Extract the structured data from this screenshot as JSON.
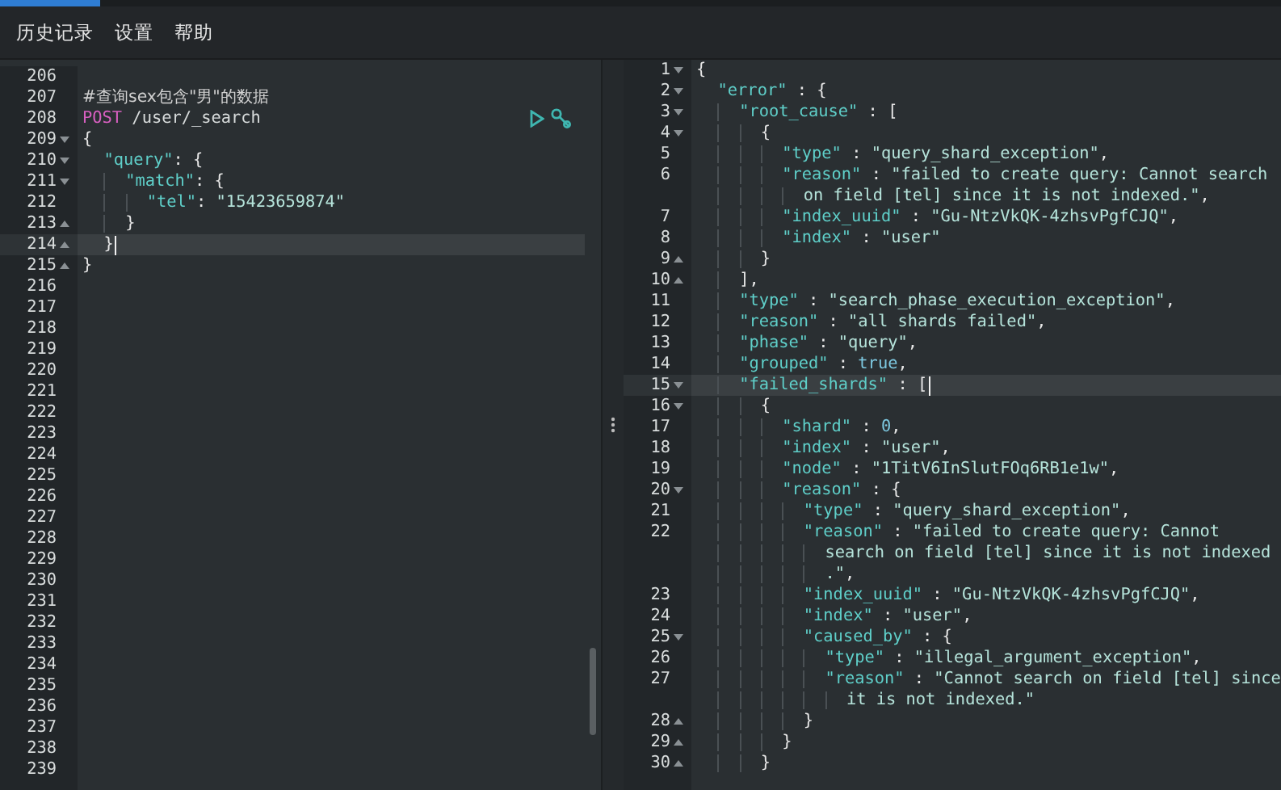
{
  "menu": [
    {
      "label": "历史记录"
    },
    {
      "label": "设置"
    },
    {
      "label": "帮助"
    }
  ],
  "request_editor": {
    "lines": [
      {
        "number": "206",
        "fold_start": false,
        "fold_end": false,
        "active": false,
        "actions": false
      },
      {
        "number": "207",
        "fold_start": false,
        "fold_end": false,
        "active": false,
        "actions": false,
        "tokens": [
          {
            "kind": "comment",
            "text": "#查询sex包含\"男\"的数据"
          }
        ]
      },
      {
        "number": "208",
        "fold_start": false,
        "fold_end": false,
        "active": false,
        "actions": true,
        "tokens": [
          {
            "kind": "method",
            "text": "POST"
          },
          {
            "kind": "path",
            "text": " /user/_search"
          }
        ]
      },
      {
        "number": "209",
        "fold_start": true,
        "fold_end": false,
        "active": false,
        "actions": false,
        "tokens": [
          {
            "kind": "punct",
            "text": "{"
          }
        ]
      },
      {
        "number": "210",
        "fold_start": true,
        "fold_end": false,
        "active": false,
        "actions": false,
        "tokens": [
          {
            "kind": "key",
            "text": "  \"query\""
          },
          {
            "kind": "punct",
            "text": ": {"
          }
        ]
      },
      {
        "number": "211",
        "fold_start": true,
        "fold_end": false,
        "active": false,
        "actions": false,
        "tokens": [
          {
            "kind": "key",
            "text": "    \"match\""
          },
          {
            "kind": "punct",
            "text": ": {"
          }
        ]
      },
      {
        "number": "212",
        "fold_start": false,
        "fold_end": false,
        "active": false,
        "actions": false,
        "tokens": [
          {
            "kind": "key",
            "text": "      \"tel\""
          },
          {
            "kind": "punct",
            "text": ": "
          },
          {
            "kind": "string",
            "text": "\"15423659874\""
          }
        ]
      },
      {
        "number": "213",
        "fold_start": false,
        "fold_end": true,
        "active": false,
        "actions": false,
        "tokens": [
          {
            "kind": "punct",
            "text": "    }"
          }
        ]
      },
      {
        "number": "214",
        "fold_start": false,
        "fold_end": true,
        "active": true,
        "actions": false,
        "tokens": [
          {
            "kind": "punct",
            "text": "  }"
          }
        ]
      },
      {
        "number": "215",
        "fold_start": false,
        "fold_end": true,
        "active": false,
        "actions": false,
        "tokens": [
          {
            "kind": "punct",
            "text": "}"
          }
        ]
      },
      {
        "number": "216",
        "fold_start": false,
        "fold_end": false,
        "active": false,
        "actions": false
      },
      {
        "number": "217",
        "fold_start": false,
        "fold_end": false,
        "active": false,
        "actions": false
      },
      {
        "number": "218",
        "fold_start": false,
        "fold_end": false,
        "active": false,
        "actions": false
      },
      {
        "number": "219",
        "fold_start": false,
        "fold_end": false,
        "active": false,
        "actions": false
      },
      {
        "number": "220",
        "fold_start": false,
        "fold_end": false,
        "active": false,
        "actions": false
      },
      {
        "number": "221",
        "fold_start": false,
        "fold_end": false,
        "active": false,
        "actions": false
      },
      {
        "number": "222",
        "fold_start": false,
        "fold_end": false,
        "active": false,
        "actions": false
      },
      {
        "number": "223",
        "fold_start": false,
        "fold_end": false,
        "active": false,
        "actions": false
      },
      {
        "number": "224",
        "fold_start": false,
        "fold_end": false,
        "active": false,
        "actions": false
      },
      {
        "number": "225",
        "fold_start": false,
        "fold_end": false,
        "active": false,
        "actions": false
      },
      {
        "number": "226",
        "fold_start": false,
        "fold_end": false,
        "active": false,
        "actions": false
      },
      {
        "number": "227",
        "fold_start": false,
        "fold_end": false,
        "active": false,
        "actions": false
      },
      {
        "number": "228",
        "fold_start": false,
        "fold_end": false,
        "active": false,
        "actions": false
      },
      {
        "number": "229",
        "fold_start": false,
        "fold_end": false,
        "active": false,
        "actions": false
      },
      {
        "number": "230",
        "fold_start": false,
        "fold_end": false,
        "active": false,
        "actions": false
      },
      {
        "number": "231",
        "fold_start": false,
        "fold_end": false,
        "active": false,
        "actions": false
      },
      {
        "number": "232",
        "fold_start": false,
        "fold_end": false,
        "active": false,
        "actions": false
      },
      {
        "number": "233",
        "fold_start": false,
        "fold_end": false,
        "active": false,
        "actions": false
      },
      {
        "number": "234",
        "fold_start": false,
        "fold_end": false,
        "active": false,
        "actions": false
      },
      {
        "number": "235",
        "fold_start": false,
        "fold_end": false,
        "active": false,
        "actions": false
      },
      {
        "number": "236",
        "fold_start": false,
        "fold_end": false,
        "active": false,
        "actions": false
      },
      {
        "number": "237",
        "fold_start": false,
        "fold_end": false,
        "active": false,
        "actions": false
      },
      {
        "number": "238",
        "fold_start": false,
        "fold_end": false,
        "active": false,
        "actions": false
      },
      {
        "number": "239",
        "fold_start": false,
        "fold_end": false,
        "active": false,
        "actions": false
      }
    ]
  },
  "response_viewer": {
    "lines": [
      {
        "number": "1",
        "fold_start": true,
        "fold_end": false,
        "active": false,
        "tokens": [
          {
            "kind": "punct",
            "text": "{"
          }
        ]
      },
      {
        "number": "2",
        "fold_start": true,
        "fold_end": false,
        "active": false,
        "tokens": [
          {
            "kind": "key",
            "text": "  \"error\""
          },
          {
            "kind": "punct",
            "text": " : {"
          }
        ]
      },
      {
        "number": "3",
        "fold_start": true,
        "fold_end": false,
        "active": false,
        "tokens": [
          {
            "kind": "key",
            "text": "    \"root_cause\""
          },
          {
            "kind": "punct",
            "text": " : ["
          }
        ]
      },
      {
        "number": "4",
        "fold_start": true,
        "fold_end": false,
        "active": false,
        "tokens": [
          {
            "kind": "punct",
            "text": "      {"
          }
        ]
      },
      {
        "number": "5",
        "fold_start": false,
        "fold_end": false,
        "active": false,
        "tokens": [
          {
            "kind": "key",
            "text": "        \"type\""
          },
          {
            "kind": "punct",
            "text": " : "
          },
          {
            "kind": "string",
            "text": "\"query_shard_exception\""
          },
          {
            "kind": "punct",
            "text": ","
          }
        ]
      },
      {
        "number": "6",
        "fold_start": false,
        "fold_end": false,
        "active": false,
        "tokens": [
          {
            "kind": "key",
            "text": "        \"reason\""
          },
          {
            "kind": "punct",
            "text": " : "
          },
          {
            "kind": "string",
            "text": "\"failed to create query: Cannot search"
          },
          {
            "kind": "string",
            "text": "          on field [tel] since it is not indexed.\"",
            "wrap": true
          },
          {
            "kind": "punct",
            "text": ","
          }
        ]
      },
      {
        "number": "7",
        "fold_start": false,
        "fold_end": false,
        "active": false,
        "tokens": [
          {
            "kind": "key",
            "text": "        \"index_uuid\""
          },
          {
            "kind": "punct",
            "text": " : "
          },
          {
            "kind": "string",
            "text": "\"Gu-NtzVkQK-4zhsvPgfCJQ\""
          },
          {
            "kind": "punct",
            "text": ","
          }
        ]
      },
      {
        "number": "8",
        "fold_start": false,
        "fold_end": false,
        "active": false,
        "tokens": [
          {
            "kind": "key",
            "text": "        \"index\""
          },
          {
            "kind": "punct",
            "text": " : "
          },
          {
            "kind": "string",
            "text": "\"user\""
          }
        ]
      },
      {
        "number": "9",
        "fold_start": false,
        "fold_end": true,
        "active": false,
        "tokens": [
          {
            "kind": "punct",
            "text": "      }"
          }
        ]
      },
      {
        "number": "10",
        "fold_start": false,
        "fold_end": true,
        "active": false,
        "tokens": [
          {
            "kind": "punct",
            "text": "    ],"
          }
        ]
      },
      {
        "number": "11",
        "fold_start": false,
        "fold_end": false,
        "active": false,
        "tokens": [
          {
            "kind": "key",
            "text": "    \"type\""
          },
          {
            "kind": "punct",
            "text": " : "
          },
          {
            "kind": "string",
            "text": "\"search_phase_execution_exception\""
          },
          {
            "kind": "punct",
            "text": ","
          }
        ]
      },
      {
        "number": "12",
        "fold_start": false,
        "fold_end": false,
        "active": false,
        "tokens": [
          {
            "kind": "key",
            "text": "    \"reason\""
          },
          {
            "kind": "punct",
            "text": " : "
          },
          {
            "kind": "string",
            "text": "\"all shards failed\""
          },
          {
            "kind": "punct",
            "text": ","
          }
        ]
      },
      {
        "number": "13",
        "fold_start": false,
        "fold_end": false,
        "active": false,
        "tokens": [
          {
            "kind": "key",
            "text": "    \"phase\""
          },
          {
            "kind": "punct",
            "text": " : "
          },
          {
            "kind": "string",
            "text": "\"query\""
          },
          {
            "kind": "punct",
            "text": ","
          }
        ]
      },
      {
        "number": "14",
        "fold_start": false,
        "fold_end": false,
        "active": false,
        "tokens": [
          {
            "kind": "key",
            "text": "    \"grouped\""
          },
          {
            "kind": "punct",
            "text": " : "
          },
          {
            "kind": "literal",
            "text": "true"
          },
          {
            "kind": "punct",
            "text": ","
          }
        ]
      },
      {
        "number": "15",
        "fold_start": true,
        "fold_end": false,
        "active": true,
        "tokens": [
          {
            "kind": "key",
            "text": "    \"failed_shards\""
          },
          {
            "kind": "punct",
            "text": " : ["
          }
        ]
      },
      {
        "number": "16",
        "fold_start": true,
        "fold_end": false,
        "active": false,
        "tokens": [
          {
            "kind": "punct",
            "text": "      {"
          }
        ]
      },
      {
        "number": "17",
        "fold_start": false,
        "fold_end": false,
        "active": false,
        "tokens": [
          {
            "kind": "key",
            "text": "        \"shard\""
          },
          {
            "kind": "punct",
            "text": " : "
          },
          {
            "kind": "literal",
            "text": "0"
          },
          {
            "kind": "punct",
            "text": ","
          }
        ]
      },
      {
        "number": "18",
        "fold_start": false,
        "fold_end": false,
        "active": false,
        "tokens": [
          {
            "kind": "key",
            "text": "        \"index\""
          },
          {
            "kind": "punct",
            "text": " : "
          },
          {
            "kind": "string",
            "text": "\"user\""
          },
          {
            "kind": "punct",
            "text": ","
          }
        ]
      },
      {
        "number": "19",
        "fold_start": false,
        "fold_end": false,
        "active": false,
        "tokens": [
          {
            "kind": "key",
            "text": "        \"node\""
          },
          {
            "kind": "punct",
            "text": " : "
          },
          {
            "kind": "string",
            "text": "\"1TitV6InSlutFOq6RB1e1w\""
          },
          {
            "kind": "punct",
            "text": ","
          }
        ]
      },
      {
        "number": "20",
        "fold_start": true,
        "fold_end": false,
        "active": false,
        "tokens": [
          {
            "kind": "key",
            "text": "        \"reason\""
          },
          {
            "kind": "punct",
            "text": " : {"
          }
        ]
      },
      {
        "number": "21",
        "fold_start": false,
        "fold_end": false,
        "active": false,
        "tokens": [
          {
            "kind": "key",
            "text": "          \"type\""
          },
          {
            "kind": "punct",
            "text": " : "
          },
          {
            "kind": "string",
            "text": "\"query_shard_exception\""
          },
          {
            "kind": "punct",
            "text": ","
          }
        ]
      },
      {
        "number": "22",
        "fold_start": false,
        "fold_end": false,
        "active": false,
        "tokens": [
          {
            "kind": "key",
            "text": "          \"reason\""
          },
          {
            "kind": "punct",
            "text": " : "
          },
          {
            "kind": "string",
            "text": "\"failed to create query: Cannot"
          },
          {
            "kind": "string",
            "text": "            search on field [tel] since it is not indexed",
            "wrap": true
          },
          {
            "kind": "string",
            "text": "            .\"",
            "wrap": true
          },
          {
            "kind": "punct",
            "text": ","
          }
        ]
      },
      {
        "number": "23",
        "fold_start": false,
        "fold_end": false,
        "active": false,
        "tokens": [
          {
            "kind": "key",
            "text": "          \"index_uuid\""
          },
          {
            "kind": "punct",
            "text": " : "
          },
          {
            "kind": "string",
            "text": "\"Gu-NtzVkQK-4zhsvPgfCJQ\""
          },
          {
            "kind": "punct",
            "text": ","
          }
        ]
      },
      {
        "number": "24",
        "fold_start": false,
        "fold_end": false,
        "active": false,
        "tokens": [
          {
            "kind": "key",
            "text": "          \"index\""
          },
          {
            "kind": "punct",
            "text": " : "
          },
          {
            "kind": "string",
            "text": "\"user\""
          },
          {
            "kind": "punct",
            "text": ","
          }
        ]
      },
      {
        "number": "25",
        "fold_start": true,
        "fold_end": false,
        "active": false,
        "tokens": [
          {
            "kind": "key",
            "text": "          \"caused_by\""
          },
          {
            "kind": "punct",
            "text": " : {"
          }
        ]
      },
      {
        "number": "26",
        "fold_start": false,
        "fold_end": false,
        "active": false,
        "tokens": [
          {
            "kind": "key",
            "text": "            \"type\""
          },
          {
            "kind": "punct",
            "text": " : "
          },
          {
            "kind": "string",
            "text": "\"illegal_argument_exception\""
          },
          {
            "kind": "punct",
            "text": ","
          }
        ]
      },
      {
        "number": "27",
        "fold_start": false,
        "fold_end": false,
        "active": false,
        "tokens": [
          {
            "kind": "key",
            "text": "            \"reason\""
          },
          {
            "kind": "punct",
            "text": " : "
          },
          {
            "kind": "string",
            "text": "\"Cannot search on field [tel] since"
          },
          {
            "kind": "string",
            "text": "              it is not indexed.\"",
            "wrap": true
          }
        ]
      },
      {
        "number": "28",
        "fold_start": false,
        "fold_end": true,
        "active": false,
        "tokens": [
          {
            "kind": "punct",
            "text": "          }"
          }
        ]
      },
      {
        "number": "29",
        "fold_start": false,
        "fold_end": true,
        "active": false,
        "tokens": [
          {
            "kind": "punct",
            "text": "        }"
          }
        ]
      },
      {
        "number": "30",
        "fold_start": false,
        "fold_end": true,
        "active": false,
        "tokens": [
          {
            "kind": "punct",
            "text": "      }"
          }
        ]
      }
    ]
  }
}
